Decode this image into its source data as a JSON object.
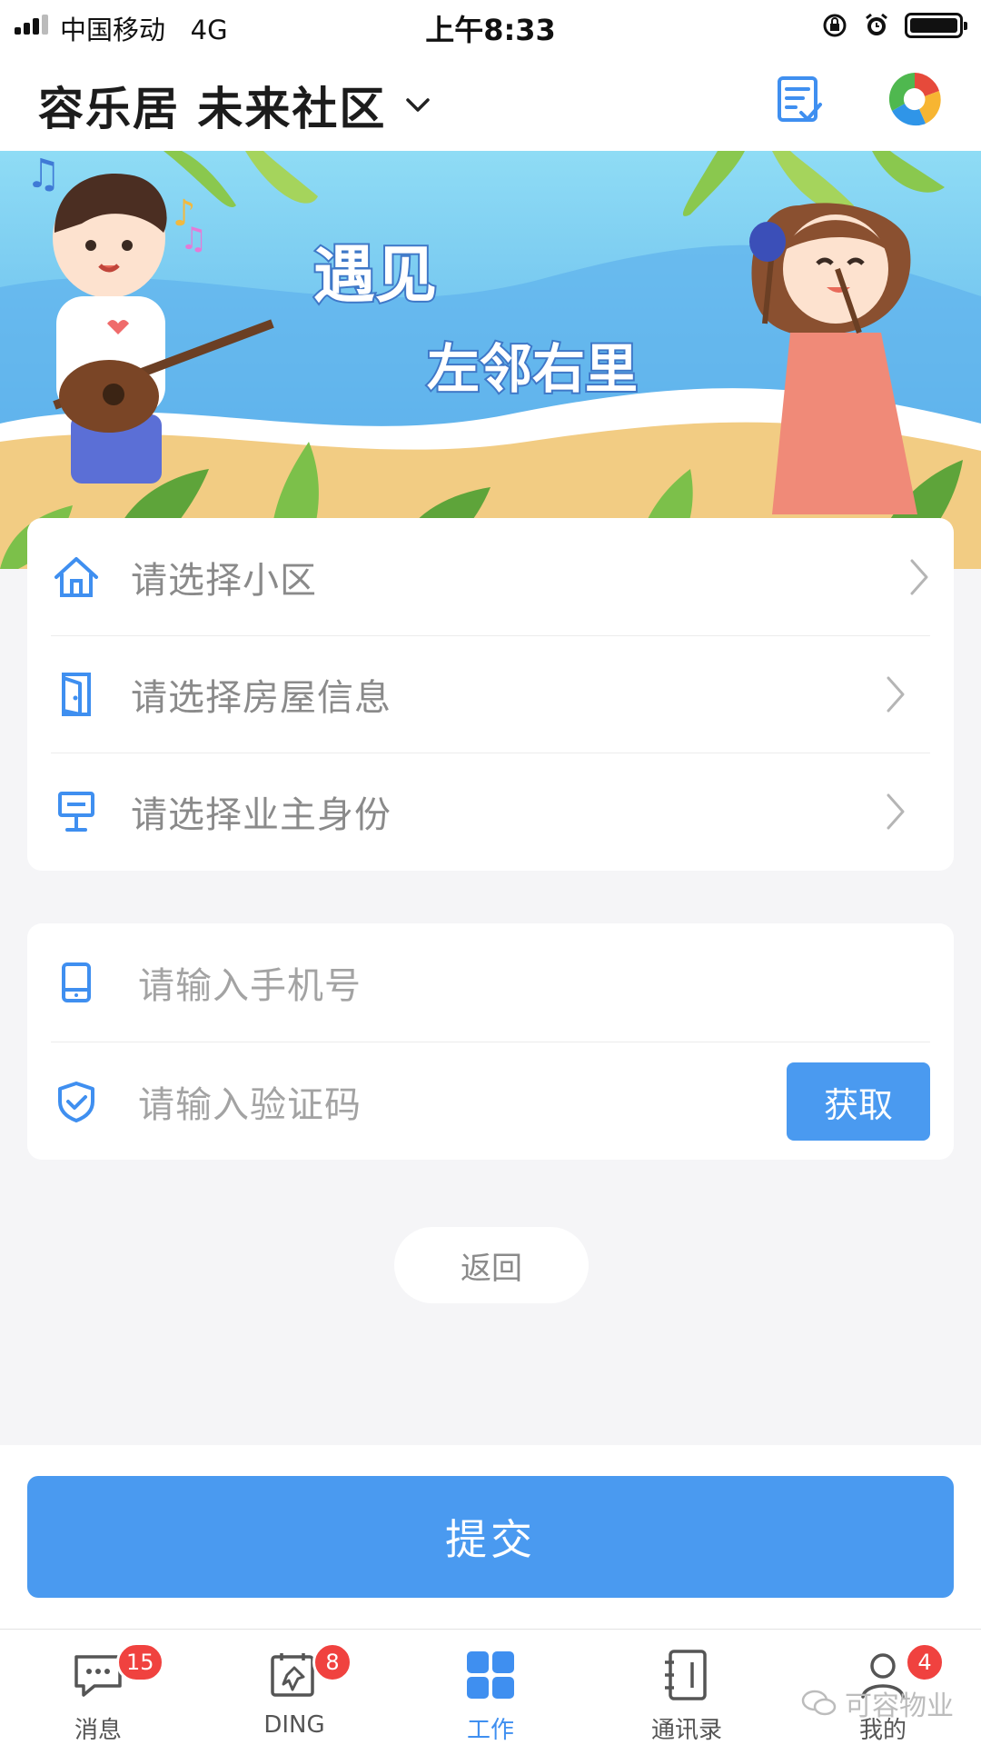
{
  "status_bar": {
    "carrier": "中国移动",
    "network": "4G",
    "time": "上午8:33"
  },
  "header": {
    "title": "容乐居 未来社区",
    "chevron_icon": "chevron-down-icon",
    "task_icon": "task-list-icon",
    "avatar_icon": "colorful-app-logo-icon"
  },
  "banner": {
    "line1": "遇见",
    "line2": "左邻右里"
  },
  "select_card": {
    "rows": [
      {
        "icon": "house-icon",
        "label": "请选择小区"
      },
      {
        "icon": "door-icon",
        "label": "请选择房屋信息"
      },
      {
        "icon": "lamp-icon",
        "label": "请选择业主身份"
      }
    ]
  },
  "input_card": {
    "phone_placeholder": "请输入手机号",
    "code_placeholder": "请输入验证码",
    "get_code_label": "获取"
  },
  "back_label": "返回",
  "submit_label": "提交",
  "tabbar": {
    "tabs": [
      {
        "label": "消息",
        "badge": "15",
        "icon": "message-icon"
      },
      {
        "label": "DING",
        "badge": "8",
        "icon": "ding-pin-icon"
      },
      {
        "label": "工作",
        "badge": "",
        "icon": "work-grid-icon"
      },
      {
        "label": "通讯录",
        "badge": "",
        "icon": "contacts-book-icon"
      },
      {
        "label": "我的",
        "badge": "4",
        "icon": "person-icon"
      }
    ]
  },
  "watermark": "可容物业",
  "colors": {
    "accent": "#4a9af0",
    "badge": "#f0423f",
    "background": "#f5f5f7"
  }
}
